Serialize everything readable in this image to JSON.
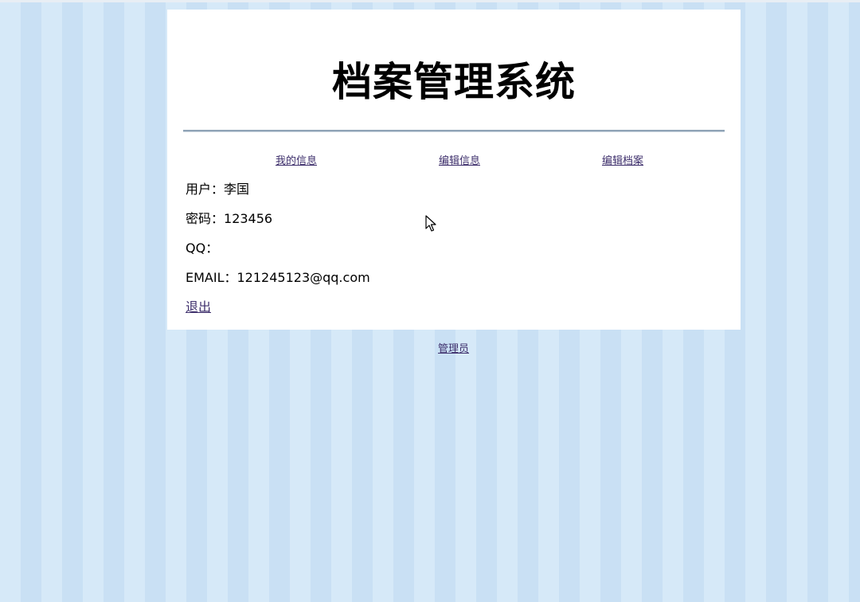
{
  "header": {
    "title": "档案管理系统"
  },
  "nav": {
    "items": [
      {
        "label": "我的信息"
      },
      {
        "label": "编辑信息"
      },
      {
        "label": "编辑档案"
      }
    ]
  },
  "user_info": {
    "username_label": "用户：",
    "username_value": "李国",
    "password_label": "密码：",
    "password_value": "123456",
    "qq_label": "QQ：",
    "qq_value": "",
    "email_label": "EMAIL：",
    "email_value": "121245123@qq.com"
  },
  "actions": {
    "logout_label": "退出"
  },
  "footer": {
    "admin_label": "管理员"
  },
  "colors": {
    "link": "#3d2e6b",
    "background": "#cfe4f6",
    "panel": "#ffffff"
  },
  "icons": {
    "cursor": "mouse-pointer-icon"
  }
}
